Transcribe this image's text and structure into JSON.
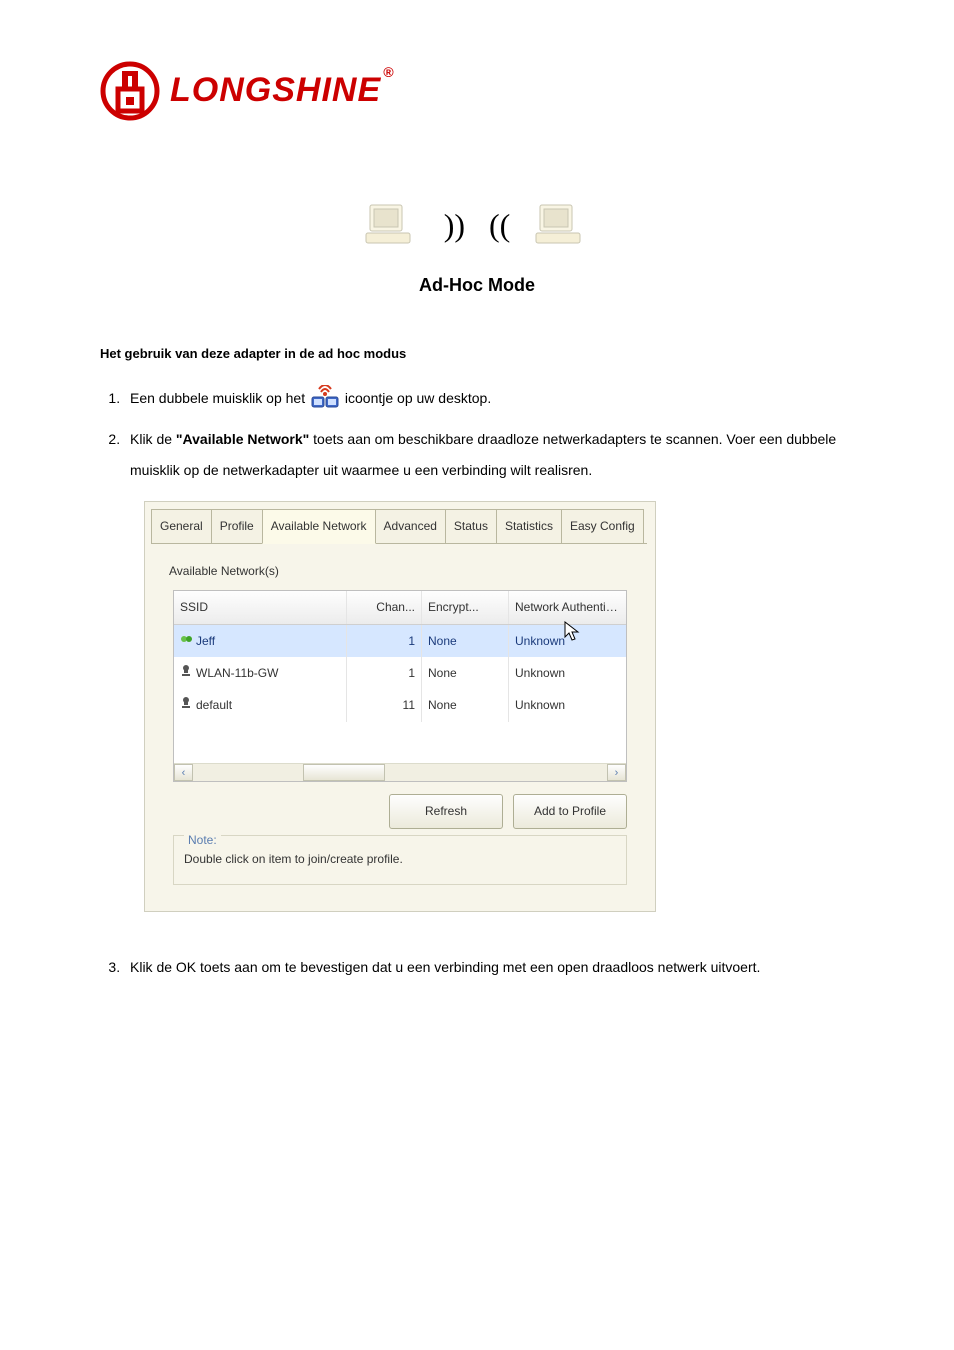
{
  "logo": {
    "text": "LONGSHINE",
    "registered": "®"
  },
  "hero": {
    "wave_right": "))",
    "wave_left": "((",
    "title": "Ad-Hoc Mode"
  },
  "heading": "Het gebruik van deze adapter in de ad hoc modus",
  "step1": {
    "pre": "Een dubbele muisklik op het ",
    "post": " icoontje op uw desktop."
  },
  "step2": {
    "pre": "Klik de ",
    "bold": "\"Available Network\"",
    "post": " toets aan om beschikbare draadloze netwerkadapters te scannen. Voer een dubbele muisklik op de netwerkadapter uit waarmee u een verbinding wilt realisren."
  },
  "step3": "Klik de OK toets aan om te bevestigen dat u een verbinding met een open draadloos netwerk uitvoert.",
  "dialog": {
    "tabs": {
      "general": "General",
      "profile": "Profile",
      "available": "Available Network",
      "advanced": "Advanced",
      "status": "Status",
      "statistics": "Statistics",
      "easy": "Easy Config"
    },
    "panel_label": "Available Network(s)",
    "columns": {
      "ssid": "SSID",
      "chan": "Chan...",
      "enc": "Encrypt...",
      "auth": "Network Authenticati..."
    },
    "rows": [
      {
        "ssid": "Jeff",
        "chan": "1",
        "enc": "None",
        "auth": "Unknown",
        "selected": true,
        "icon": "adhoc"
      },
      {
        "ssid": "WLAN-11b-GW",
        "chan": "1",
        "enc": "None",
        "auth": "Unknown",
        "selected": false,
        "icon": "infra"
      },
      {
        "ssid": "default",
        "chan": "11",
        "enc": "None",
        "auth": "Unknown",
        "selected": false,
        "icon": "infra"
      }
    ],
    "buttons": {
      "refresh": "Refresh",
      "add": "Add to Profile"
    },
    "note_legend": "Note:",
    "note_text": "Double click on item to join/create profile.",
    "scroll_left": "‹",
    "scroll_right": "›"
  }
}
